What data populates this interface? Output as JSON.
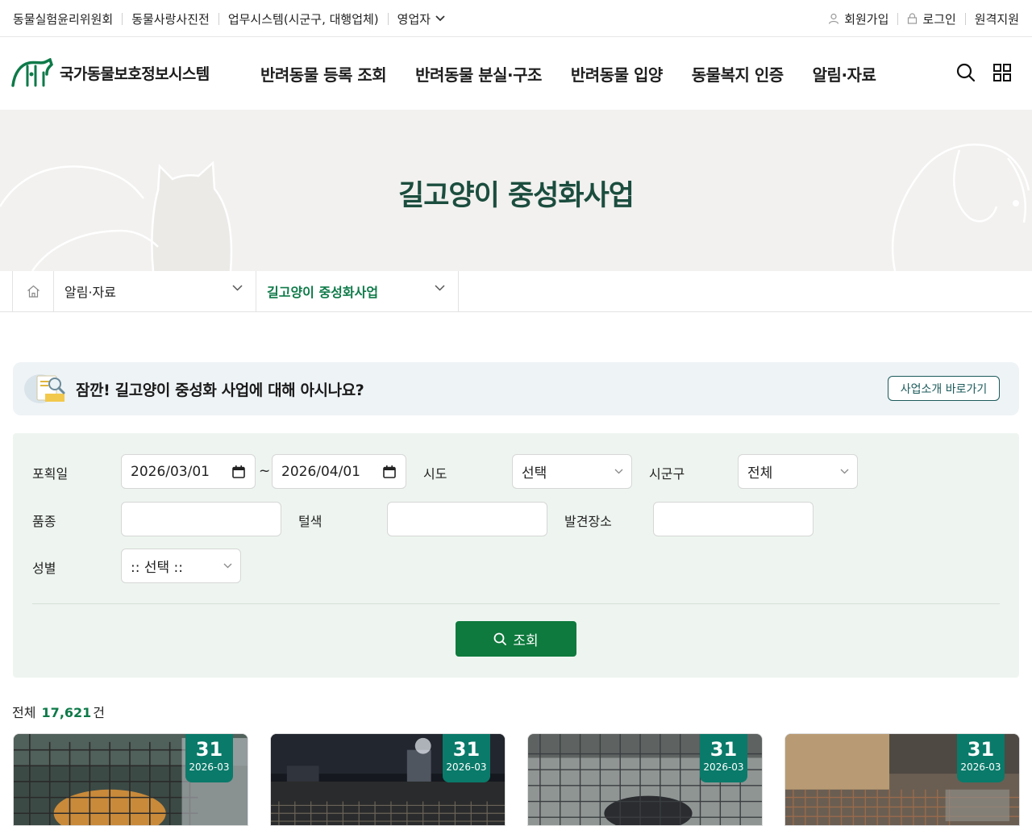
{
  "util": {
    "left_links": [
      "동물실험윤리위원회",
      "동물사랑사진전",
      "업무시스템(시군구, 대행업체)",
      "영업자"
    ],
    "signup": "회원가입",
    "login": "로그인",
    "remote": "원격지원"
  },
  "logo": {
    "text": "국가동물보호정보시스템"
  },
  "gnb": {
    "menu": [
      "반려동물 등록 조회",
      "반려동물 분실·구조",
      "반려동물 입양",
      "동물복지 인증",
      "알림·자료"
    ],
    "icons": [
      "search-icon",
      "grid-menu-icon"
    ]
  },
  "visual": {
    "title": "길고양이 중성화사업"
  },
  "breadcrumb": {
    "level1": "알림·자료",
    "level2": "길고양이 중성화사업"
  },
  "info": {
    "text": "잠깐! 길고양이 중성화 사업에 대해 아시나요?",
    "button": "사업소개 바로가기"
  },
  "search": {
    "capture_date_label": "포획일",
    "date_from": "2026/03/01",
    "date_sep": "~",
    "date_to": "2026/04/01",
    "sido_label": "시도",
    "sido_value": "선택",
    "sigungu_label": "시군구",
    "sigungu_value": "전체",
    "breed_label": "품종",
    "breed_value": "",
    "color_label": "털색",
    "color_value": "",
    "place_label": "발견장소",
    "place_value": "",
    "gender_label": "성별",
    "gender_value": ":: 선택 ::",
    "submit": "조회"
  },
  "total": {
    "prefix": "전체",
    "count": "17,621",
    "suffix": "건"
  },
  "cards": [
    {
      "day": "31",
      "ym": "2026-03"
    },
    {
      "day": "31",
      "ym": "2026-03"
    },
    {
      "day": "31",
      "ym": "2026-03"
    },
    {
      "day": "31",
      "ym": "2026-03"
    }
  ],
  "colors": {
    "brand_green": "#0e7a3d",
    "accent_teal": "#0a7a6a",
    "title_green": "#1b4d3e"
  }
}
